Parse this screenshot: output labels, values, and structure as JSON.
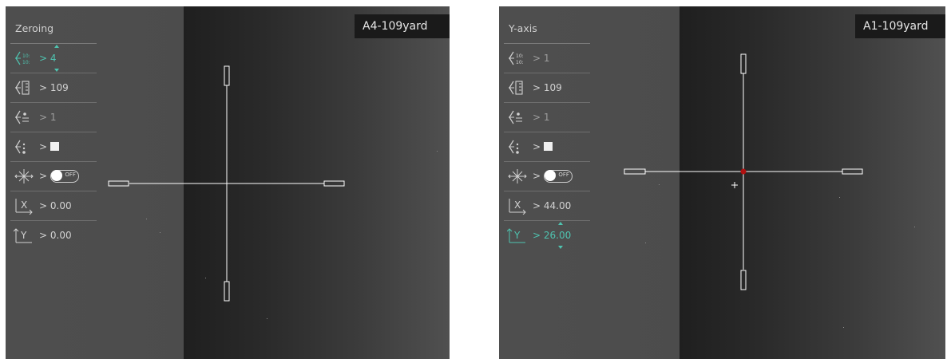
{
  "left": {
    "profile": "A4-109yard",
    "menu_title": "Zeroing",
    "items": [
      {
        "icon": "zeroing-profile-icon",
        "value": "> 4"
      },
      {
        "icon": "zeroing-distance-icon",
        "value": "> 109"
      },
      {
        "icon": "reticle-style-icon",
        "value": "> 1"
      },
      {
        "icon": "reticle-color-icon",
        "value": ">"
      },
      {
        "icon": "freeze-icon",
        "value": ">",
        "toggle": "OFF"
      },
      {
        "icon": "x-axis-icon",
        "value": "> 0.00"
      },
      {
        "icon": "y-axis-icon",
        "value": "> 0.00"
      }
    ]
  },
  "right": {
    "profile": "A1-109yard",
    "menu_title": "Y-axis",
    "items": [
      {
        "icon": "zeroing-profile-icon",
        "value": "> 1"
      },
      {
        "icon": "zeroing-distance-icon",
        "value": "> 109"
      },
      {
        "icon": "reticle-style-icon",
        "value": "> 1"
      },
      {
        "icon": "reticle-color-icon",
        "value": ">"
      },
      {
        "icon": "freeze-icon",
        "value": ">",
        "toggle": "OFF"
      },
      {
        "icon": "x-axis-icon",
        "value": "> 44.00"
      },
      {
        "icon": "y-axis-icon",
        "value": "> 26.00"
      }
    ]
  },
  "colors": {
    "accent": "#4fc4b0",
    "reticle": "#ffffff",
    "center_dot": "#b01010"
  }
}
